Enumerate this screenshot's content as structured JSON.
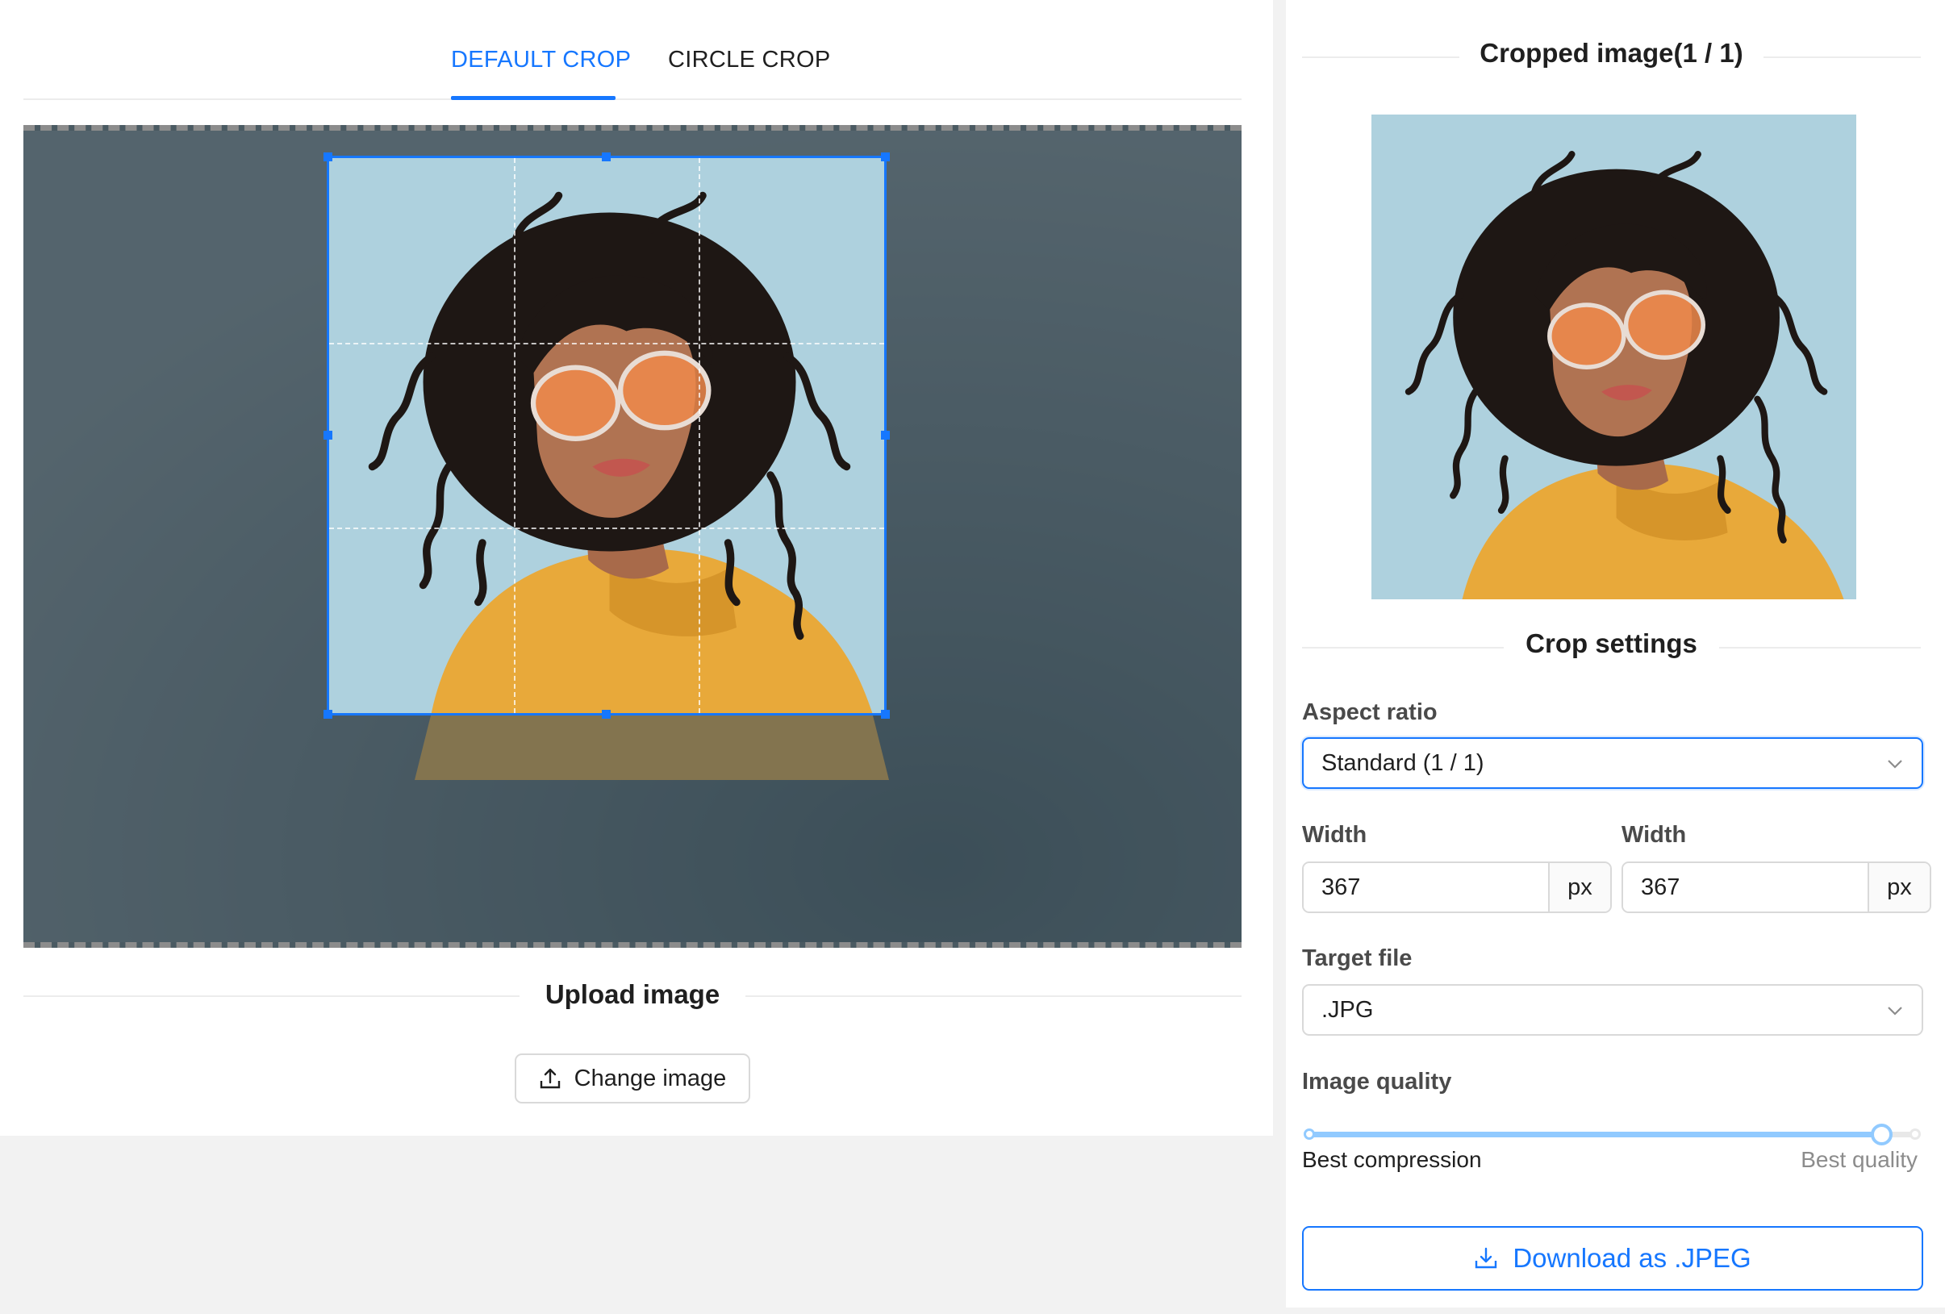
{
  "tabs": [
    {
      "label": "DEFAULT CROP",
      "active": true
    },
    {
      "label": "CIRCLE CROP",
      "active": false
    }
  ],
  "crop_area": {
    "photo": "portrait-woman-curly-hair-orange-glasses",
    "selection_aspect": "1 / 1"
  },
  "upload": {
    "title": "Upload image",
    "change_button": "Change image",
    "change_icon": "upload-icon"
  },
  "preview": {
    "title": "Cropped image(1 / 1)"
  },
  "settings": {
    "title": "Crop settings",
    "aspect_ratio_label": "Aspect ratio",
    "aspect_ratio_value": "Standard (1 / 1)",
    "width_label_1": "Width",
    "width_value_1": "367",
    "width_label_2": "Width",
    "width_value_2": "367",
    "unit": "px",
    "target_file_label": "Target file",
    "target_file_value": ".JPG",
    "quality_label": "Image quality",
    "quality_value": 0.94,
    "quality_min_label": "Best compression",
    "quality_max_label": "Best quality",
    "download_button": "Download as .JPEG",
    "download_icon": "download-icon"
  },
  "colors": {
    "accent": "#1677ff",
    "slider": "#91caff",
    "backdrop": "#4a5a62",
    "photo_bg": "#aed1de",
    "sweater": "#e8a93a"
  }
}
